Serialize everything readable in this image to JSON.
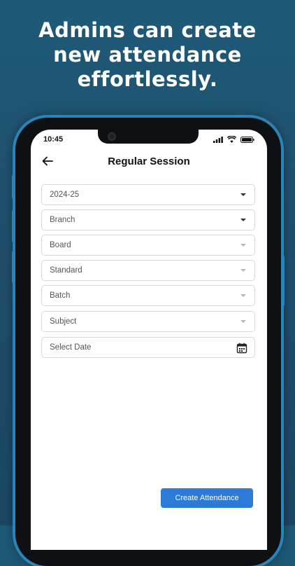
{
  "headline": {
    "line1": "Admins can create",
    "line2": "new attendance",
    "line3": "effortlessly."
  },
  "status_bar": {
    "time": "10:45"
  },
  "header": {
    "title": "Regular Session"
  },
  "form": {
    "fields": [
      {
        "label": "2024-25",
        "type": "dropdown",
        "enabled": true
      },
      {
        "label": "Branch",
        "type": "dropdown",
        "enabled": true
      },
      {
        "label": "Board",
        "type": "dropdown",
        "enabled": false
      },
      {
        "label": "Standard",
        "type": "dropdown",
        "enabled": false
      },
      {
        "label": "Batch",
        "type": "dropdown",
        "enabled": false
      },
      {
        "label": "Subject",
        "type": "dropdown",
        "enabled": false
      },
      {
        "label": "Select Date",
        "type": "date"
      }
    ]
  },
  "actions": {
    "create_label": "Create Attendance"
  },
  "colors": {
    "accent": "#2b7bd8",
    "background": "#1f4f6c",
    "phone_frame": "#2a84b8"
  }
}
